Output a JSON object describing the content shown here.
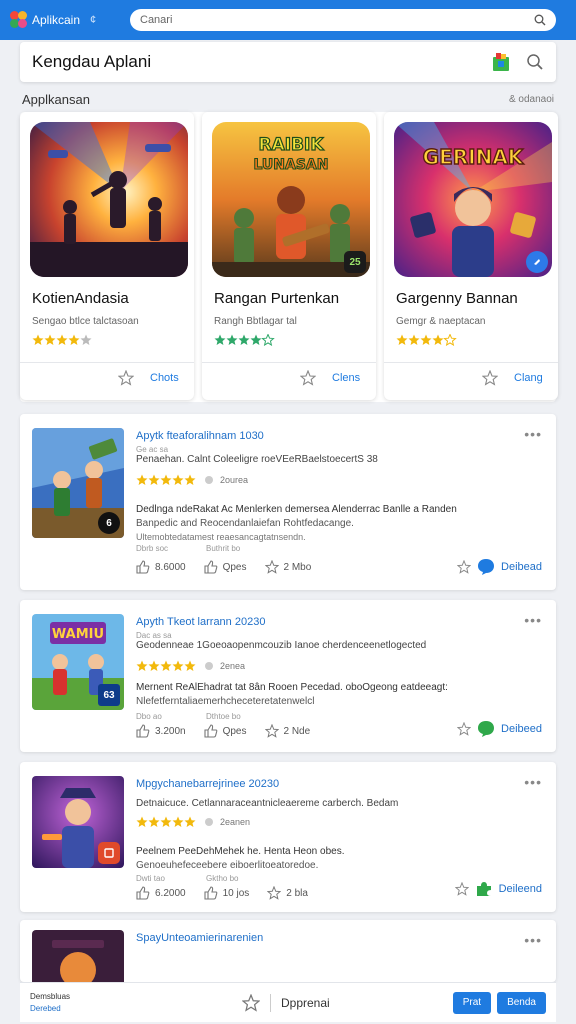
{
  "app": {
    "name": "Aplikcain",
    "caret": "¢"
  },
  "search": {
    "placeholder": "Canari"
  },
  "header": {
    "title": "Kengdau Aplani"
  },
  "section": {
    "title": "Applkansan",
    "more": "& odanaoi"
  },
  "featured": [
    {
      "name": "KotienAndasia",
      "developer": "Sengao btlce talctasoan",
      "rating": 3.5,
      "action": "Chots"
    },
    {
      "name": "Rangan Purtenkan",
      "developer": "Rangh Bbtlagar tal",
      "rating": 4,
      "action": "Clens"
    },
    {
      "name": "Gargenny Bannan",
      "developer": "Gemgr & naeptacan",
      "rating": 4.5,
      "action": "Clang"
    }
  ],
  "featured_art_titles": [
    "RAIBIK LUNASAN",
    "GERINAK"
  ],
  "featured_badge": "25",
  "list": [
    {
      "title": "Apytk fteaforalihnam 1030",
      "subtitle": "Ge ac sa",
      "desc1": "Penaehan. Calnt Coleeligre roeVEeRBaelstoecertS 38",
      "rating": 4.5,
      "rating_count": "2ourea",
      "desc2": "Dedlnga ndeRakat Ac Menlerken demersea Alenderrac Banlle a Randen",
      "desc3": "Banpedic and Reocendanlaiefan Rohtfedacange.",
      "desc4": "Ultemobtedatamest reaesancagtatnsendn.",
      "meta": [
        "Dbrb soc",
        "Buthrit bo",
        ""
      ],
      "stats": [
        "8.6000",
        "Qpes",
        "2 Mbo"
      ],
      "badge": "6",
      "action": "Deibead"
    },
    {
      "title": "Apyth Tkeot larrann 20230",
      "subtitle": "Dac as sa",
      "desc1": "Geodenneae 1Goeoaopenmcouzib Ianoe cherdenceenetlogected",
      "rating": 4.5,
      "rating_count": "2enea",
      "desc2": "Mernent ReAlEhadrat tat 8ân Rooen Pecedad. oboOgeong eatdeeagt:",
      "desc3": "Nlefetferntaliaemerhcheceteretatenwelcl",
      "desc4": "",
      "meta": [
        "Dbo ao",
        "Dthtoe bo",
        ""
      ],
      "stats": [
        "3.200n",
        "Qpes",
        "2 Nde"
      ],
      "badge": "63",
      "thumb_title": "WAMIU",
      "action": "Deibeed"
    },
    {
      "title": "Mpgychanebarrejrinee 20230",
      "subtitle": "",
      "desc1": "Detnaicuce. Cetlannaraceantnicleaereme carberch. Bedam",
      "rating": 4.5,
      "rating_count": "2eanen",
      "desc2": "Peelnem PeeDehMehek he. Henta Heon obes.",
      "desc3": "Genoeuhefeceebere eiboerlitoeatoredoe.",
      "desc4": "",
      "meta": [
        "Dwti tao",
        "Gktho bo",
        ""
      ],
      "stats": [
        "6.2000",
        "10 jos",
        "2 bla"
      ],
      "badge": "",
      "action": "Deileend"
    },
    {
      "title": "SpayUnteoamierinarenien",
      "subtitle": "",
      "desc1": "",
      "rating": 0,
      "rating_count": "",
      "desc2": "",
      "desc3": "",
      "desc4": "",
      "meta": [],
      "stats": [],
      "badge": "",
      "action": ""
    }
  ],
  "bottom": {
    "line1": "Demsbluas",
    "line2": "Derebed",
    "mid_label": "Dpprenai",
    "btn1": "Prat",
    "btn2": "Benda"
  },
  "colors": {
    "accent": "#1f7be0",
    "star": "#f2b90c",
    "star_green": "#2fa86a"
  }
}
